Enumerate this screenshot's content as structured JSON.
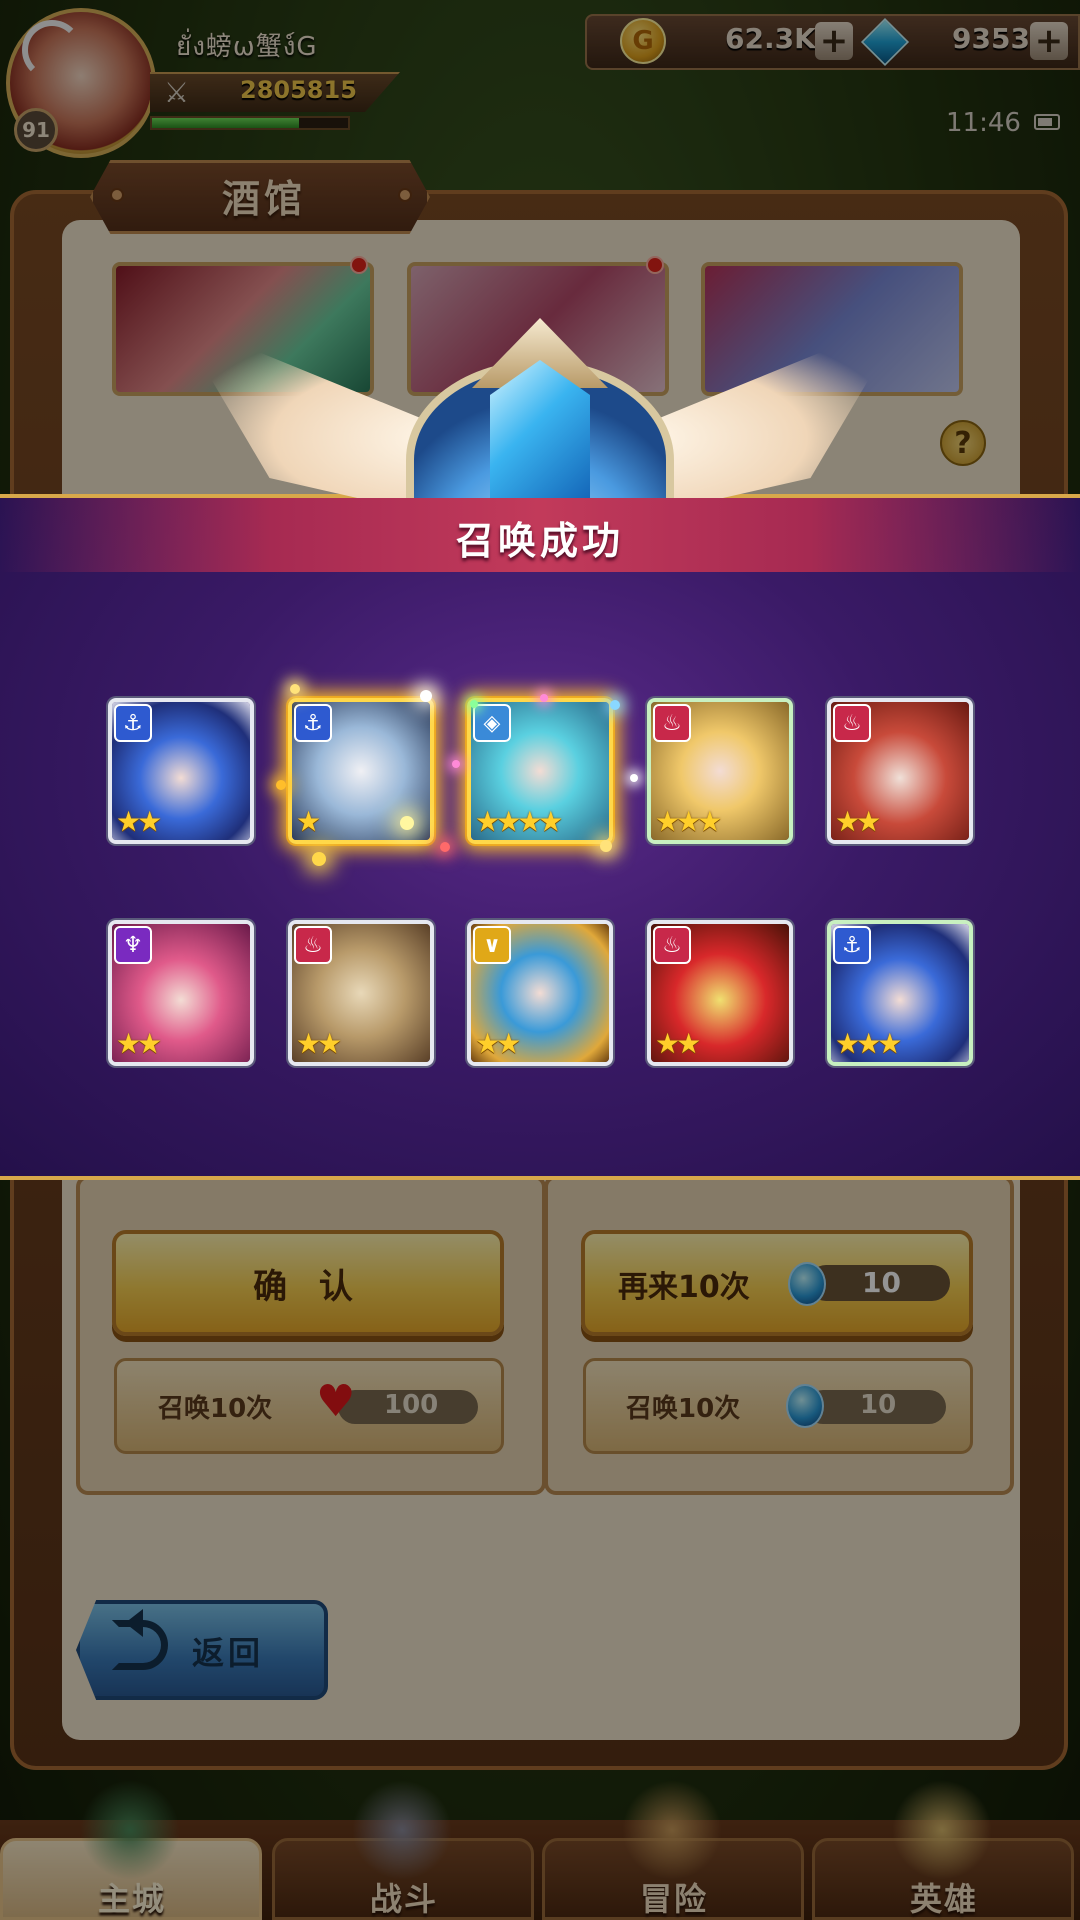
{
  "player": {
    "name": "ยั่ง螃ω蟹ง์G",
    "level": "91",
    "power": "2805815",
    "exp_fraction": 0.75
  },
  "resources": {
    "gold": "62.3K",
    "gems": "9353",
    "plus_label": "+"
  },
  "status": {
    "time": "11:46"
  },
  "icons": {
    "coin": "coin-icon",
    "gem": "gem-icon",
    "swords": "crossed-swords-icon",
    "battery": "battery-icon",
    "help": "question-mark-icon",
    "back": "return-arrow-icon",
    "heart": "heart-icon",
    "orb": "summon-orb-icon",
    "crystal": "crystal-icon"
  },
  "tavern": {
    "title": "酒馆",
    "help_label": "?",
    "banners": [
      "banner-hero-1",
      "banner-hero-2",
      "banner-hero-3"
    ],
    "confirm_label": "确 认",
    "again_label": "再来10次",
    "again_cost": "10",
    "summon_left_label": "召唤10次",
    "summon_left_cost": "100",
    "summon_right_label": "召唤10次",
    "summon_right_cost": "10",
    "back_label": "返回"
  },
  "result": {
    "title": "召唤成功",
    "heroes": [
      {
        "faction": "anchor",
        "faction_glyph": "⚓",
        "stars": 2,
        "frame": "normal"
      },
      {
        "faction": "anchor",
        "faction_glyph": "⚓",
        "stars": 1,
        "frame": "gold"
      },
      {
        "faction": "shield",
        "faction_glyph": "◈",
        "stars": 4,
        "frame": "gold"
      },
      {
        "faction": "flame",
        "faction_glyph": "♨",
        "stars": 3,
        "frame": "green"
      },
      {
        "faction": "flame",
        "faction_glyph": "♨",
        "stars": 2,
        "frame": "normal"
      },
      {
        "faction": "demon",
        "faction_glyph": "♆",
        "stars": 2,
        "frame": "normal"
      },
      {
        "faction": "flame",
        "faction_glyph": "♨",
        "stars": 2,
        "frame": "normal"
      },
      {
        "faction": "light",
        "faction_glyph": "∨",
        "stars": 2,
        "frame": "normal"
      },
      {
        "faction": "flame",
        "faction_glyph": "♨",
        "stars": 2,
        "frame": "normal"
      },
      {
        "faction": "anchor",
        "faction_glyph": "⚓",
        "stars": 3,
        "frame": "green"
      }
    ]
  },
  "nav": {
    "tabs": [
      {
        "label": "主城",
        "active": true
      },
      {
        "label": "战斗",
        "active": false
      },
      {
        "label": "冒险",
        "active": false
      },
      {
        "label": "英雄",
        "active": false
      }
    ]
  },
  "colors": {
    "accent_gold": "#f6cf52",
    "result_purple": "#3a1a66",
    "header_crimson": "#c23a5a",
    "panel_brown": "#7a4a24"
  }
}
